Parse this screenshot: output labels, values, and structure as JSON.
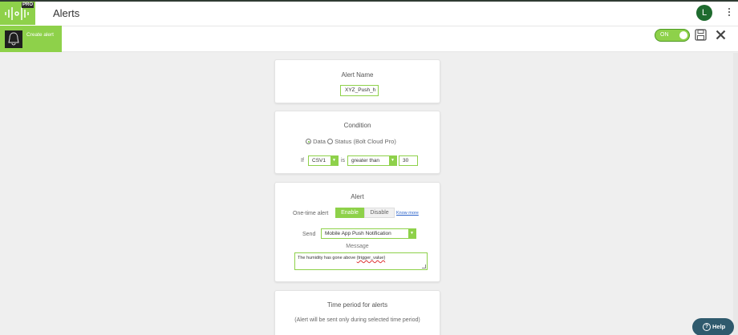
{
  "app": {
    "pro_badge": "PRO",
    "page_title": "Alerts",
    "avatar_initial": "L",
    "brand_color": "#8ed14a"
  },
  "toolbar": {
    "create_alert_label": "Create alert",
    "toggle_label": "ON"
  },
  "alert_name": {
    "title": "Alert Name",
    "value": "XYZ_Push_h"
  },
  "condition": {
    "title": "Condition",
    "option_data": "Data",
    "option_status": "Status (Bolt Cloud Pro)",
    "if_label": "If",
    "variable": "CSV1",
    "is_label": "is",
    "operator": "greater than",
    "threshold": "30"
  },
  "alert": {
    "title": "Alert",
    "one_time_label": "One-time alert",
    "enable_label": "Enable",
    "disable_label": "Disable",
    "know_more": "Know more",
    "send_label": "Send",
    "send_value": "Mobile App Push Notification",
    "message_label": "Message",
    "message_prefix": "The humidity has gone above ",
    "message_var": "{trigger_value}"
  },
  "time_period": {
    "title": "Time period for alerts",
    "subtitle": "(Alert will be sent only during selected time period)"
  },
  "help": {
    "label": "Help",
    "icon": "question-icon"
  }
}
